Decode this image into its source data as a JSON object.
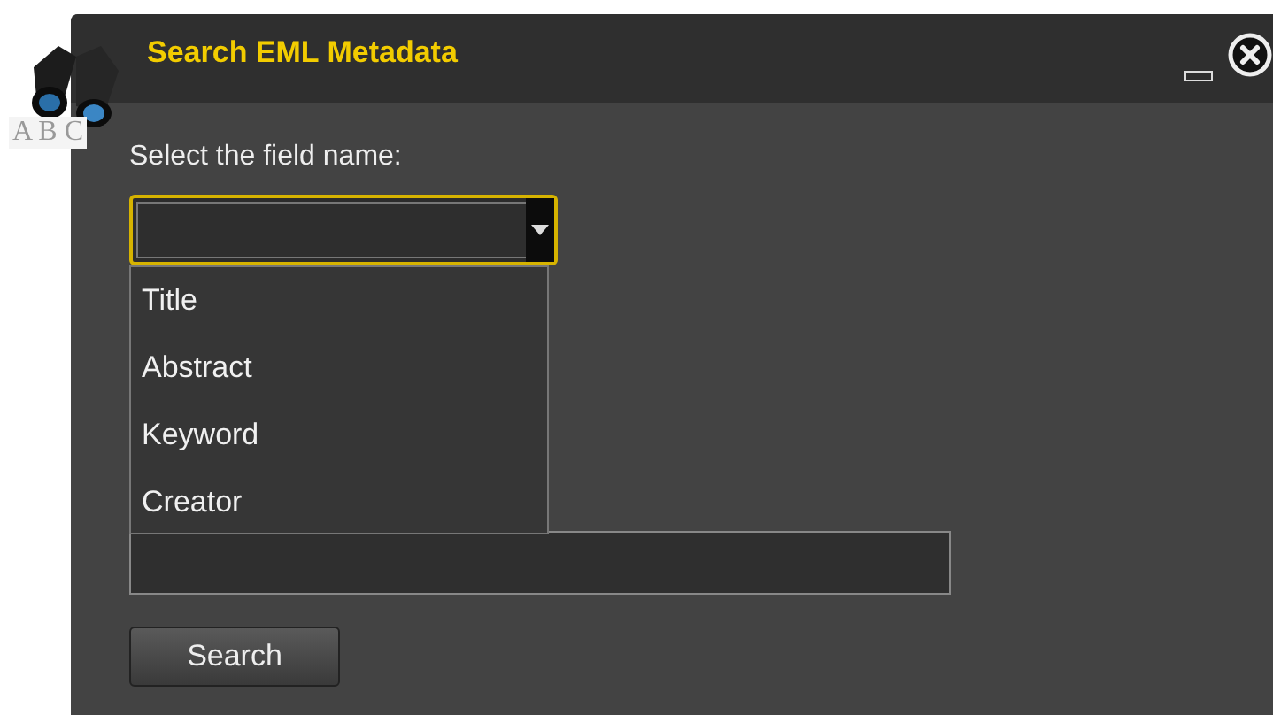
{
  "window": {
    "title": "Search EML Metadata",
    "icon_caption": "A B C"
  },
  "field_name": {
    "label": "Select the field name:",
    "expanded": true,
    "options": [
      {
        "label": "Title"
      },
      {
        "label": "Abstract"
      },
      {
        "label": "Keyword"
      },
      {
        "label": "Creator"
      }
    ]
  },
  "buttons": [
    {
      "label": "Search"
    }
  ]
}
